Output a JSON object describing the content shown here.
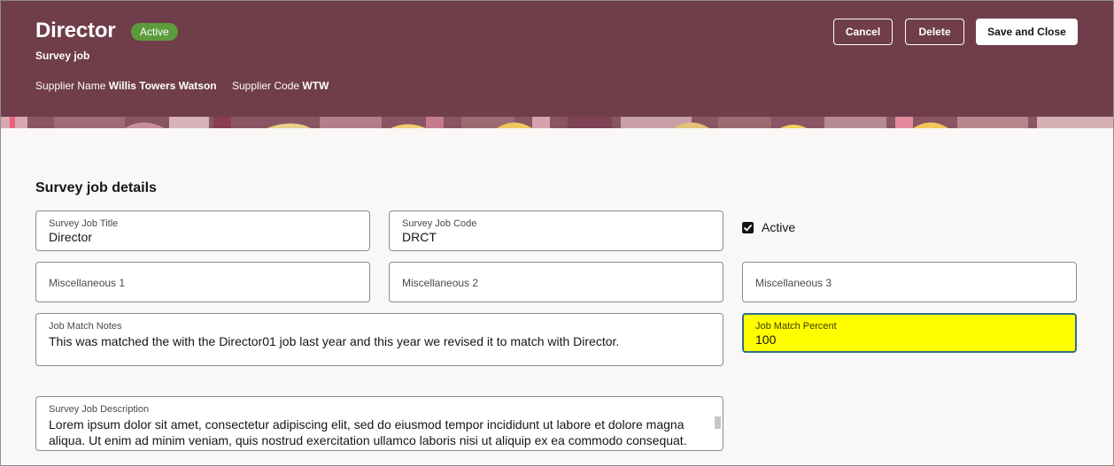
{
  "header": {
    "title": "Director",
    "status_badge": "Active",
    "subtitle": "Survey job",
    "supplier_name_label": "Supplier Name",
    "supplier_name_value": "Willis Towers Watson",
    "supplier_code_label": "Supplier Code",
    "supplier_code_value": "WTW",
    "colors": {
      "band": "#6f3e4a",
      "badge": "#5e9b3d"
    }
  },
  "actions": {
    "cancel": "Cancel",
    "delete": "Delete",
    "save_and_close": "Save and Close"
  },
  "section": {
    "title": "Survey job details"
  },
  "fields": {
    "survey_job_title": {
      "label": "Survey Job Title",
      "value": "Director"
    },
    "survey_job_code": {
      "label": "Survey Job Code",
      "value": "DRCT"
    },
    "active": {
      "label": "Active",
      "checked": true
    },
    "misc1": {
      "placeholder": "Miscellaneous 1"
    },
    "misc2": {
      "placeholder": "Miscellaneous 2"
    },
    "misc3": {
      "placeholder": "Miscellaneous 3"
    },
    "job_match_notes": {
      "label": "Job Match Notes",
      "value": "This was matched the with the Director01 job last year and this year we revised it to match with Director."
    },
    "job_match_percent": {
      "label": "Job Match Percent",
      "value": "100",
      "highlight_color": "#ffff00"
    },
    "survey_job_description": {
      "label": "Survey Job Description",
      "value": "Lorem ipsum dolor sit amet, consectetur adipiscing elit, sed do eiusmod tempor incididunt ut labore et dolore magna aliqua. Ut enim ad minim veniam, quis nostrud exercitation ullamco laboris nisi ut aliquip ex ea commodo consequat."
    }
  }
}
